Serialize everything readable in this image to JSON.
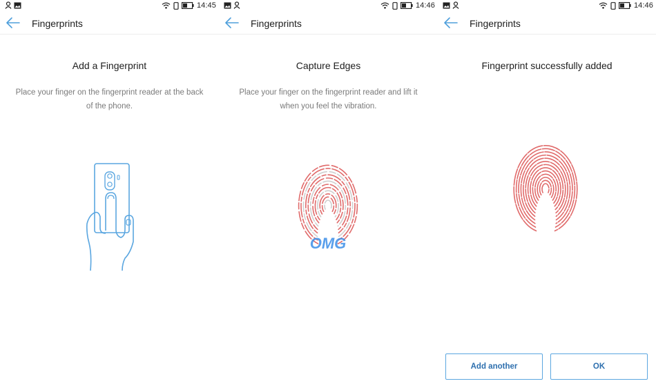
{
  "screens": [
    {
      "status": {
        "time": "14:45"
      },
      "app_title": "Fingerprints",
      "heading": "Add a Fingerprint",
      "description": "Place your finger on the fingerprint reader at the back of the phone."
    },
    {
      "status": {
        "time": "14:46"
      },
      "app_title": "Fingerprints",
      "heading": "Capture Edges",
      "description": "Place your finger on the fingerprint reader and lift it when you feel the vibration.",
      "watermark": "OMG"
    },
    {
      "status": {
        "time": "14:46"
      },
      "app_title": "Fingerprints",
      "heading": "Fingerprint successfully added",
      "buttons": {
        "add_another": "Add another",
        "ok": "OK"
      }
    }
  ],
  "colors": {
    "accent": "#5aa6e0",
    "button_text": "#2d6fae",
    "fingerprint_red": "#e06a6a",
    "fingerprint_grey": "#cfcfcf",
    "watermark_blue": "#3d8fe8",
    "watermark_orange": "#f2a33a"
  },
  "icons": [
    "person-icon",
    "image-icon",
    "wifi-icon",
    "vibrate-icon",
    "battery-icon",
    "back-arrow-icon"
  ]
}
